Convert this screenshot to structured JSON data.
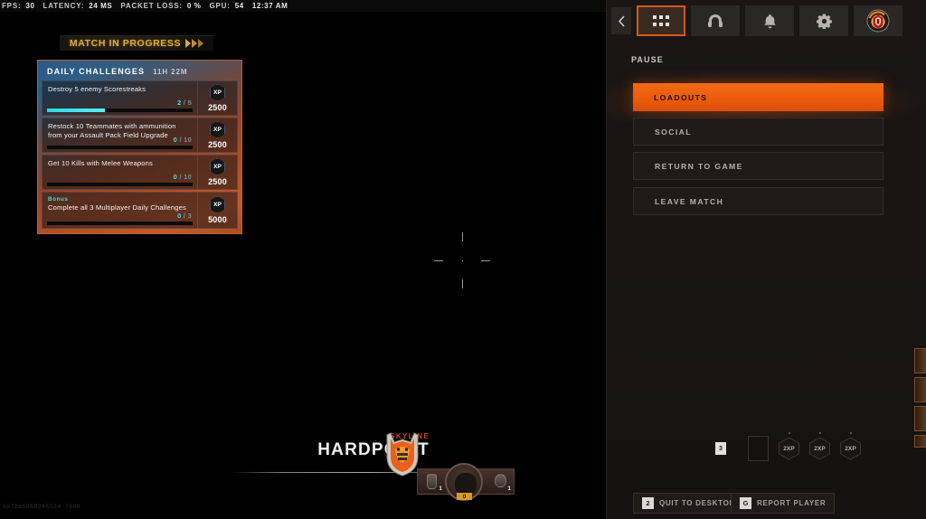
{
  "perf_bar": {
    "items": [
      {
        "label": "FPS:",
        "value": "30"
      },
      {
        "label": "LATENCY:",
        "value": "24 MS"
      },
      {
        "label": "PACKET LOSS:",
        "value": "0 %"
      },
      {
        "label": "GPU:",
        "value": "54"
      }
    ],
    "clock": "12:37 AM"
  },
  "match_banner": {
    "text": "MATCH IN PROGRESS"
  },
  "challenges": {
    "title": "DAILY CHALLENGES",
    "timer": "11H 22M",
    "rows": [
      {
        "bonus_label": "",
        "description": "Destroy 5 enemy Scorestreaks",
        "current": "2",
        "separator": "/",
        "goal": "5",
        "progress_pct": 40,
        "xp_badge": "XP",
        "xp_value": "2500"
      },
      {
        "bonus_label": "",
        "description": "Restock 10 Teammates with ammunition from your Assault Pack Field Upgrade",
        "current": "0",
        "separator": "/",
        "goal": "10",
        "progress_pct": 0,
        "xp_badge": "XP",
        "xp_value": "2500"
      },
      {
        "bonus_label": "",
        "description": "Get 10 Kills with Melee Weapons",
        "current": "0",
        "separator": "/",
        "goal": "10",
        "progress_pct": 0,
        "xp_badge": "XP",
        "xp_value": "2500"
      },
      {
        "bonus_label": "Bonus",
        "description": "Complete all 3 Multiplayer Daily Challenges",
        "current": "0",
        "separator": "/",
        "goal": "3",
        "progress_pct": 0,
        "xp_badge": "XP",
        "xp_value": "5000"
      }
    ]
  },
  "hud": {
    "map_name": "SKYLINE",
    "mode_name": "HARDPOINT",
    "equipment": {
      "lethal_count": "1",
      "tactical_count": "1",
      "ammo_count": "0"
    }
  },
  "pause_panel": {
    "section_label": "PAUSE",
    "nav_icons": [
      {
        "name": "back-arrow-icon",
        "label": ""
      },
      {
        "name": "grid-menu-icon",
        "label": "",
        "active": true
      },
      {
        "name": "headset-icon",
        "label": ""
      },
      {
        "name": "bell-icon",
        "label": ""
      },
      {
        "name": "gear-icon",
        "label": ""
      },
      {
        "name": "clan-emblem-icon",
        "label": ""
      }
    ],
    "menu_items": [
      {
        "label": "LOADOUTS",
        "selected": true
      },
      {
        "label": "SOCIAL",
        "selected": false
      },
      {
        "label": "RETURN TO GAME",
        "selected": false
      },
      {
        "label": "LEAVE MATCH",
        "selected": false
      }
    ],
    "tokens": {
      "stack_count": "3",
      "badges": [
        "2XP",
        "2XP",
        "2XP"
      ]
    },
    "footer_buttons": [
      {
        "key": "2",
        "label": "QUIT TO DESKTOP"
      },
      {
        "key": "G",
        "label": "REPORT PLAYER"
      }
    ]
  },
  "match_id": "687265958245524 7868",
  "colors": {
    "accent_orange": "#ec5c0c",
    "banner_gold": "#e0a93b",
    "progress_cyan": "#3fe0e8",
    "map_red": "#c4452a",
    "panel_bg": "#1a1513"
  }
}
